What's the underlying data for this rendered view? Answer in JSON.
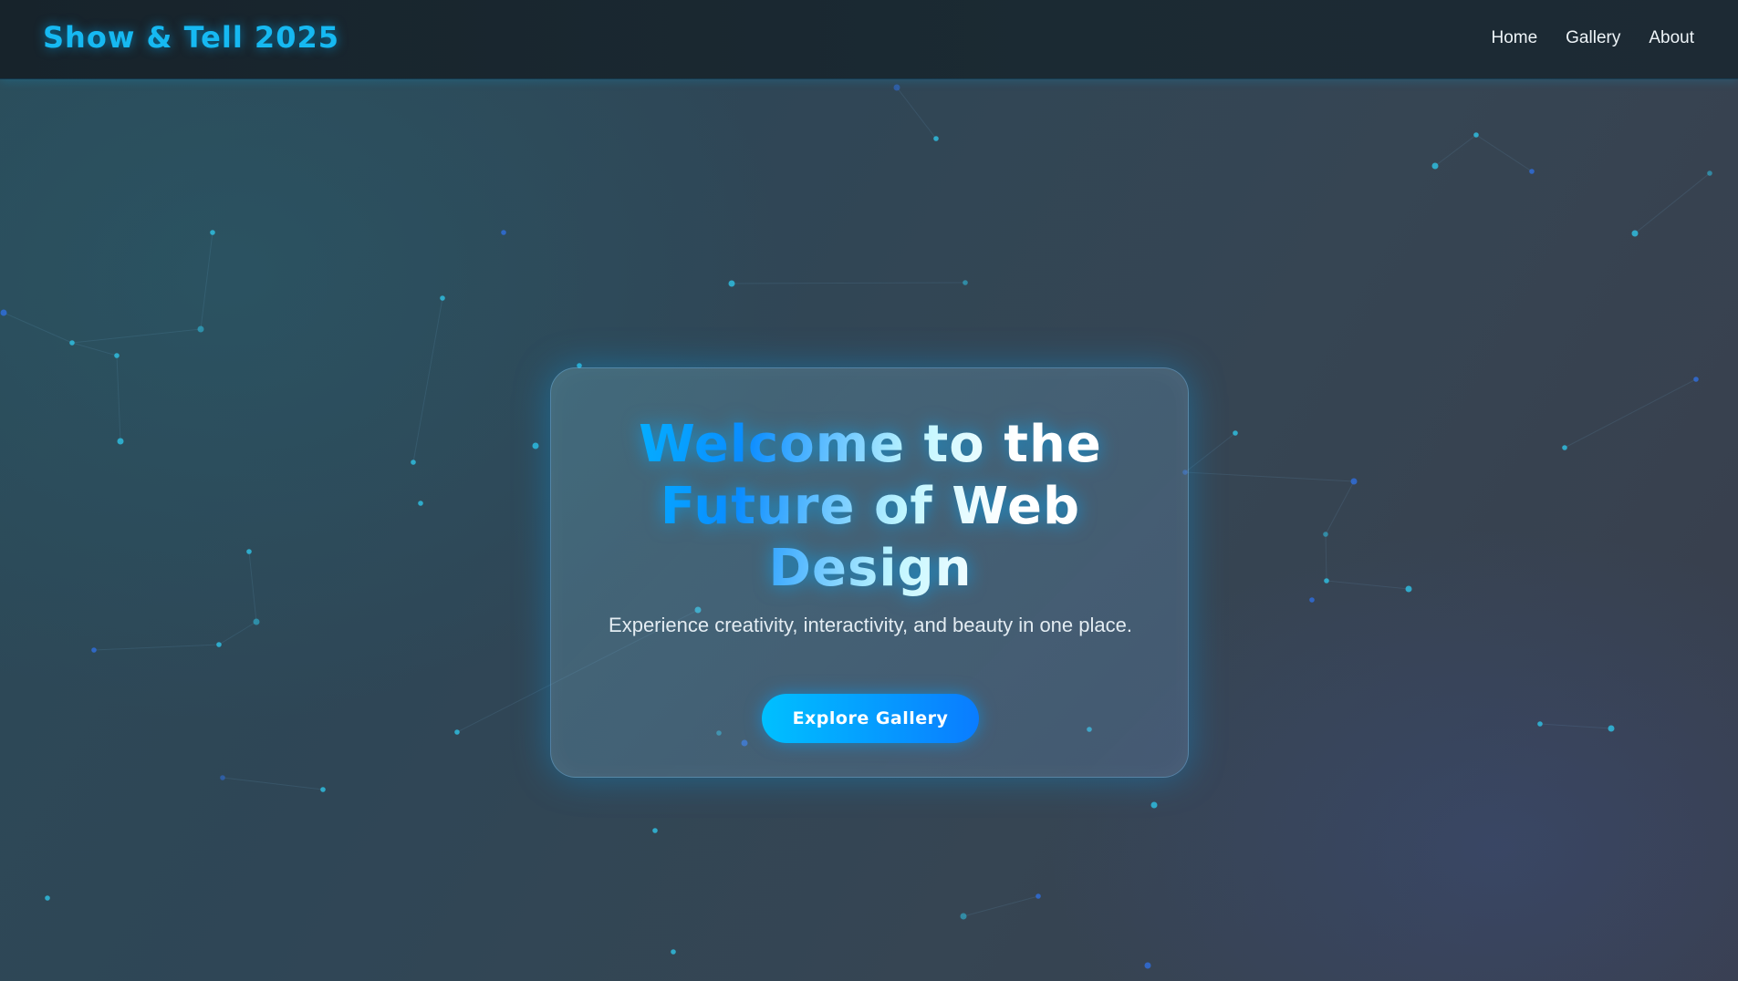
{
  "brand": {
    "title": "Show & Tell 2025"
  },
  "nav": {
    "items": [
      {
        "label": "Home"
      },
      {
        "label": "Gallery"
      },
      {
        "label": "About"
      }
    ]
  },
  "hero": {
    "title": "Welcome to the Future of Web Design",
    "subtitle": "Experience creativity, interactivity, and beauty in one place.",
    "button_label": "Explore Gallery"
  },
  "colors": {
    "accent": "#16b9f2",
    "button_start": "#00c0ff",
    "button_end": "#0a7cff",
    "particle": "#2fc3e6"
  }
}
